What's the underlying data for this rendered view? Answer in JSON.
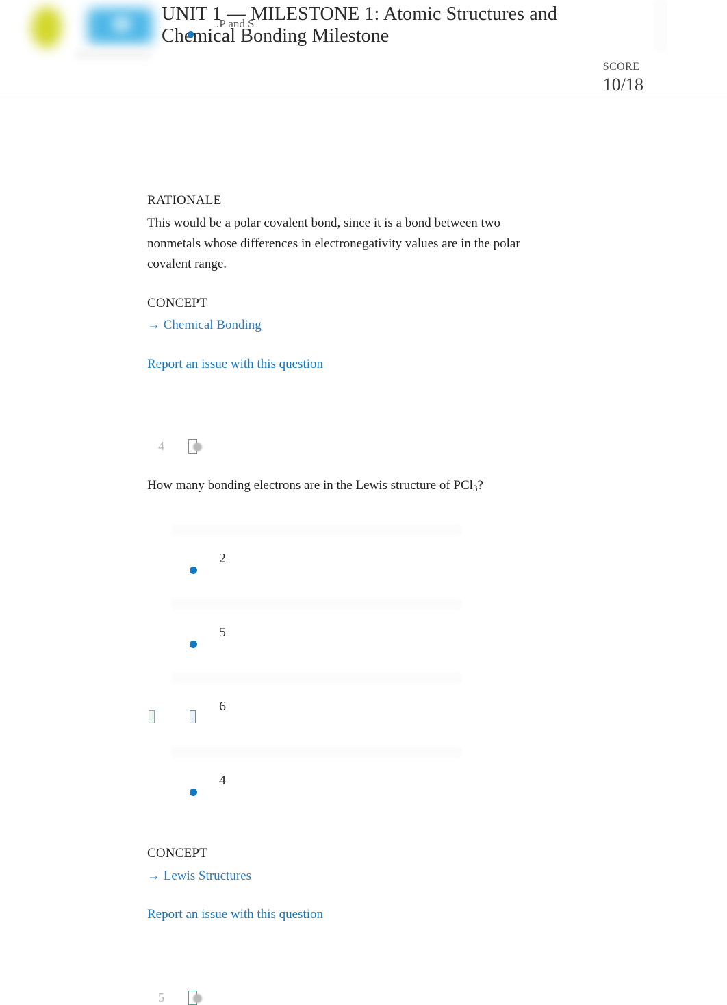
{
  "header": {
    "title": "UNIT 1 — MILESTONE 1: Atomic Structures and Chemical Bonding Milestone",
    "title_ghost_overlay": ".P and S",
    "score_label": "SCORE",
    "score_value": "10/18",
    "logo_yellow_color": "#cfd41a",
    "logo_blue_color": "#46b4e6"
  },
  "rationale_block": {
    "label": "RATIONALE",
    "text": "This would be a polar covalent bond, since it is a bond between two nonmetals whose differences in electronegativity values are in the polar covalent range.",
    "concept_label": "CONCEPT",
    "concept_link": "→ Chemical Bonding",
    "report_link": "Report an issue with this question"
  },
  "question": {
    "number": "4",
    "text_before_sub": "How many bonding electrons are in the Lewis structure of PCl",
    "subscript": "3",
    "text_after_sub": "?",
    "options": [
      {
        "label": "2",
        "selected": false,
        "correct": false
      },
      {
        "label": "5",
        "selected": false,
        "correct": false
      },
      {
        "label": "6",
        "selected": true,
        "correct": true
      },
      {
        "label": "4",
        "selected": false,
        "correct": false
      }
    ],
    "concept_label": "CONCEPT",
    "concept_link": "→ Lewis Structures",
    "report_link": "Report an issue with this question"
  },
  "next_question": {
    "number": "5"
  },
  "colors": {
    "link_blue": "#1479be",
    "radio_blue": "#1479be",
    "correct_green": "#4aa883",
    "muted_gray": "#b6b6b6"
  }
}
